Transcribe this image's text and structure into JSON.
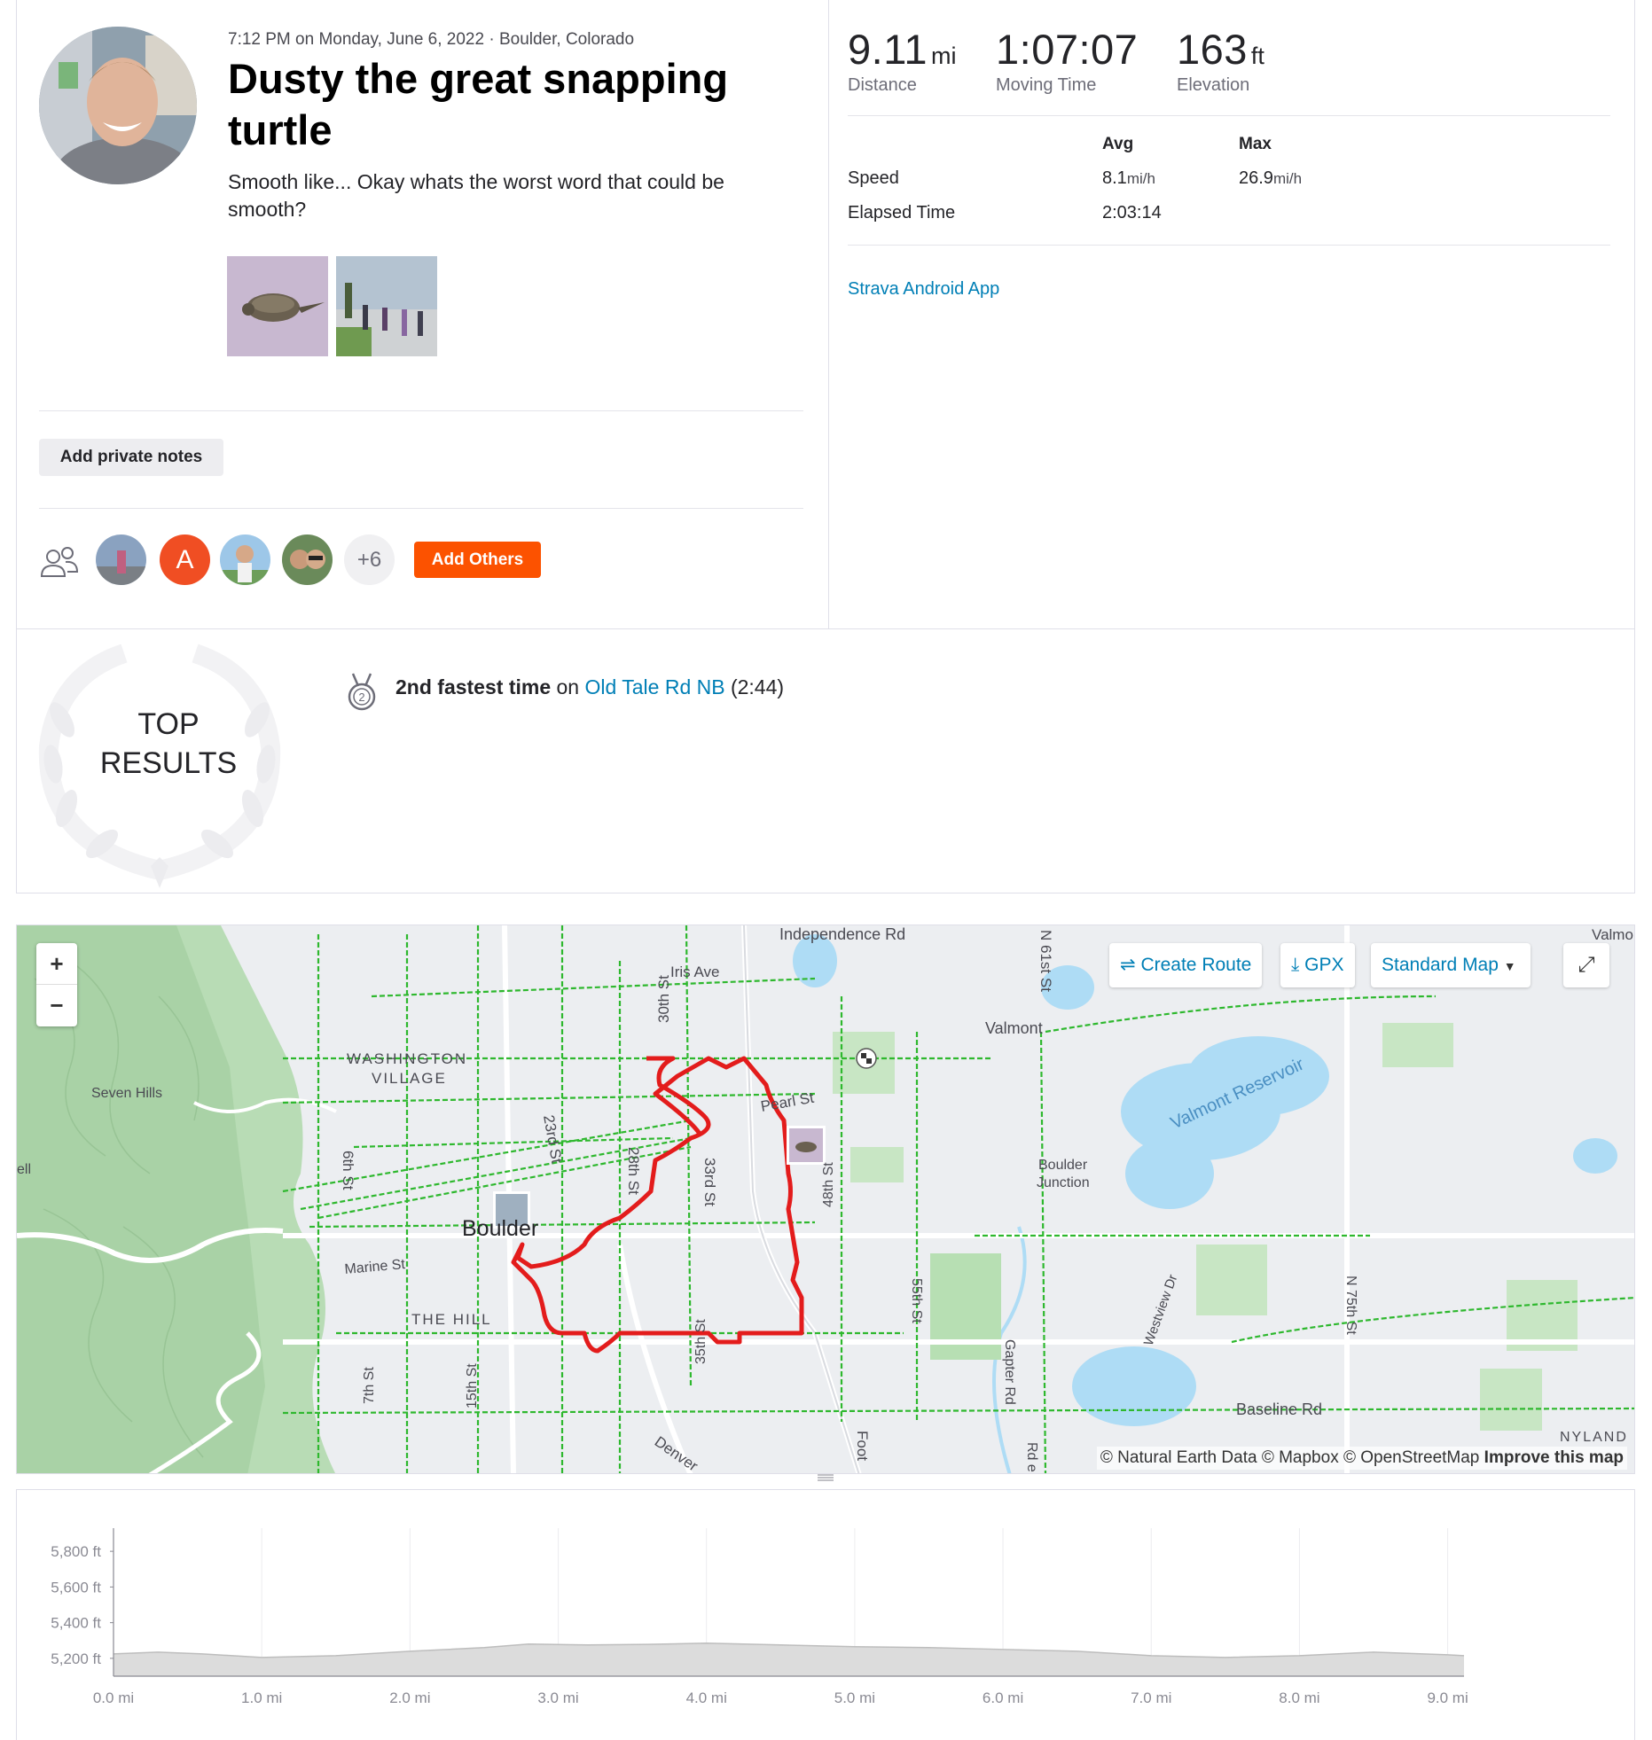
{
  "activity": {
    "meta": "7:12 PM on Monday, June 6, 2022 · Boulder, Colorado",
    "title": "Dusty the great snapping turtle",
    "description": "Smooth like... Okay whats the worst word that could be smooth?",
    "private_notes_label": "Add private notes",
    "athletes": {
      "letter_avatar": "A",
      "more_count": "+6",
      "add_others_label": "Add Others"
    }
  },
  "stats": {
    "distance": {
      "value": "9.11",
      "unit": "mi",
      "label": "Distance"
    },
    "moving_time": {
      "value": "1:07:07",
      "label": "Moving Time"
    },
    "elevation": {
      "value": "163",
      "unit": "ft",
      "label": "Elevation"
    },
    "table": {
      "avg_header": "Avg",
      "max_header": "Max",
      "speed_label": "Speed",
      "speed_avg": "8.1",
      "speed_max": "26.9",
      "speed_unit": "mi/h",
      "elapsed_label": "Elapsed Time",
      "elapsed_avg": "2:03:14"
    },
    "device": "Strava Android App"
  },
  "top_results": {
    "title_line1": "TOP",
    "title_line2": "RESULTS",
    "medal_number": "2",
    "achievement": "2nd fastest time",
    "on_text": "on",
    "segment_name": "Old Tale Rd NB",
    "segment_time": "(2:44)"
  },
  "map": {
    "zoom_in": "+",
    "zoom_out": "−",
    "create_route": "Create Route",
    "gpx": "GPX",
    "map_style": "Standard Map",
    "attribution": "© Natural Earth Data © Mapbox © OpenStreetMap",
    "improve": "Improve this map",
    "labels": {
      "independence": "Independence Rd",
      "iris": "Iris Ave",
      "valmont": "Valmont",
      "valmont_edge": "Valmo",
      "n61": "N 61st St",
      "washington1": "WASHINGTON",
      "washington2": "VILLAGE",
      "seven_hills": "Seven Hills",
      "pearl": "Pearl St",
      "s30": "30th St",
      "s23": "23rd St",
      "s6": "6th St",
      "s28": "28th St",
      "s33": "33rd St",
      "boulder": "Boulder",
      "marine": "Marine St",
      "thehill": "THE HILL",
      "s48": "48th St",
      "s55": "55th St",
      "gapter": "Gapter Rd",
      "junction1": "Boulder",
      "junction2": "Junction",
      "reservoir": "Valmont Reservoir",
      "westview": "Westview Dr",
      "n75": "N 75th St",
      "baseline": "Baseline Rd",
      "nyland": "NYLAND",
      "s35": "35th St",
      "s15": "15th St",
      "s7": "7th St",
      "denver": "Denver",
      "foot": "Foot",
      "ell": "ell",
      "rd_e": "Rd e"
    }
  },
  "elevation_chart": {
    "y_ticks": [
      "5,800 ft",
      "5,600 ft",
      "5,400 ft",
      "5,200 ft"
    ],
    "x_ticks": [
      "0.0 mi",
      "1.0 mi",
      "2.0 mi",
      "3.0 mi",
      "4.0 mi",
      "5.0 mi",
      "6.0 mi",
      "7.0 mi",
      "8.0 mi",
      "9.0 mi"
    ]
  },
  "chart_data": {
    "type": "area",
    "title": "",
    "xlabel": "",
    "ylabel": "",
    "x_unit": "mi",
    "y_unit": "ft",
    "xlim": [
      0,
      9.11
    ],
    "ylim": [
      5100,
      5900
    ],
    "grid": true,
    "series": [
      {
        "x": [
          0,
          0.3,
          0.6,
          1.0,
          1.5,
          2.0,
          2.5,
          2.8,
          3.2,
          3.6,
          4.0,
          4.5,
          5.0,
          5.5,
          6.0,
          6.5,
          7.0,
          7.5,
          8.0,
          8.5,
          9.0,
          9.11
        ],
        "values": [
          5225,
          5235,
          5225,
          5205,
          5215,
          5240,
          5260,
          5280,
          5275,
          5278,
          5285,
          5275,
          5265,
          5260,
          5250,
          5240,
          5215,
          5205,
          5215,
          5235,
          5220,
          5215
        ]
      }
    ],
    "colors": {
      "fill": "#dcdcdc",
      "stroke": "#bdbdbd"
    }
  }
}
